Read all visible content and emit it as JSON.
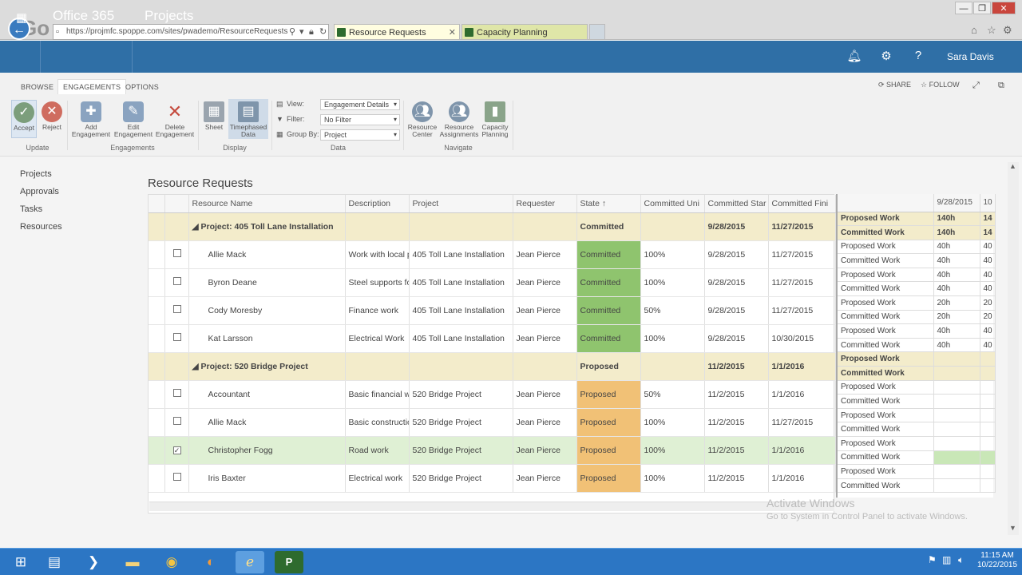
{
  "browser": {
    "address": "https://projmfc.spoppe.com/sites/pwademo/ResourceRequests",
    "tabs": [
      {
        "label": "Resource Requests"
      },
      {
        "label": "Capacity Planning"
      }
    ],
    "window_controls": [
      "—",
      "❐",
      "✕"
    ],
    "google_logo": "Go"
  },
  "suite": {
    "waffle_icon": "app-launcher-icon",
    "brand": "Office 365",
    "app": "Projects",
    "user": "Sara Davis"
  },
  "ribbon": {
    "tabs": [
      "BROWSE",
      "ENGAGEMENTS",
      "OPTIONS"
    ],
    "share": "SHARE",
    "follow": "FOLLOW",
    "groups": {
      "update": "Update",
      "engagements": "Engagements",
      "display": "Display",
      "data": "Data",
      "navigate": "Navigate"
    },
    "buttons": {
      "accept": "Accept",
      "reject": "Reject",
      "add_engagement": "Add Engagement",
      "edit_engagement": "Edit Engagement",
      "delete_engagement": "Delete Engagement",
      "sheet": "Sheet",
      "timephased": "Timephased Data",
      "resource_center": "Resource Center",
      "resource_assignments": "Resource Assignments",
      "capacity_planning": "Capacity Planning"
    },
    "data": {
      "view_label": "View:",
      "view_value": "Engagement Details",
      "filter_label": "Filter:",
      "filter_value": "No Filter",
      "groupby_label": "Group By:",
      "groupby_value": "Project"
    }
  },
  "nav": [
    "Projects",
    "Approvals",
    "Tasks",
    "Resources"
  ],
  "page_title": "Resource Requests",
  "grid": {
    "columns": [
      "Resource Name",
      "Description",
      "Project",
      "Requester",
      "State ↑",
      "Committed Uni",
      "Committed Star",
      "Committed Fini"
    ],
    "groups": [
      {
        "label": "Project: 405 Toll Lane Installation",
        "state": "Committed",
        "start": "9/28/2015",
        "finish": "11/27/2015",
        "rows": [
          {
            "name": "Allie Mack",
            "desc": "Work with local p",
            "project": "405 Toll Lane Installation",
            "requester": "Jean Pierce",
            "state": "Committed",
            "units": "100%",
            "start": "9/28/2015",
            "finish": "11/27/2015"
          },
          {
            "name": "Byron Deane",
            "desc": "Steel supports fo",
            "project": "405 Toll Lane Installation",
            "requester": "Jean Pierce",
            "state": "Committed",
            "units": "100%",
            "start": "9/28/2015",
            "finish": "11/27/2015"
          },
          {
            "name": "Cody Moresby",
            "desc": "Finance work",
            "project": "405 Toll Lane Installation",
            "requester": "Jean Pierce",
            "state": "Committed",
            "units": "50%",
            "start": "9/28/2015",
            "finish": "11/27/2015"
          },
          {
            "name": "Kat Larsson",
            "desc": "Electrical Work",
            "project": "405 Toll Lane Installation",
            "requester": "Jean Pierce",
            "state": "Committed",
            "units": "100%",
            "start": "9/28/2015",
            "finish": "10/30/2015"
          }
        ]
      },
      {
        "label": "Project: 520 Bridge Project",
        "state": "Proposed",
        "start": "11/2/2015",
        "finish": "1/1/2016",
        "rows": [
          {
            "name": "Accountant",
            "desc": "Basic financial w",
            "project": "520 Bridge Project",
            "requester": "Jean Pierce",
            "state": "Proposed",
            "units": "50%",
            "start": "11/2/2015",
            "finish": "1/1/2016"
          },
          {
            "name": "Allie Mack",
            "desc": "Basic constructio",
            "project": "520 Bridge Project",
            "requester": "Jean Pierce",
            "state": "Proposed",
            "units": "100%",
            "start": "11/2/2015",
            "finish": "11/27/2015"
          },
          {
            "name": "Christopher Fogg",
            "desc": "Road work",
            "project": "520 Bridge Project",
            "requester": "Jean Pierce",
            "state": "Proposed",
            "units": "100%",
            "start": "11/2/2015",
            "finish": "1/1/2016",
            "checked": true
          },
          {
            "name": "Iris Baxter",
            "desc": "Electrical work",
            "project": "520 Bridge Project",
            "requester": "Jean Pierce",
            "state": "Proposed",
            "units": "100%",
            "start": "11/2/2015",
            "finish": "1/1/2016"
          }
        ]
      }
    ]
  },
  "timephased": {
    "headers": [
      "",
      "9/28/2015",
      "10"
    ],
    "rows": [
      {
        "label": "Proposed Work",
        "v1": "140h",
        "v2": "14",
        "total": true
      },
      {
        "label": "Committed Work",
        "v1": "140h",
        "v2": "14",
        "total": true
      },
      {
        "label": "Proposed Work",
        "v1": "40h",
        "v2": "40"
      },
      {
        "label": "Committed Work",
        "v1": "40h",
        "v2": "40"
      },
      {
        "label": "Proposed Work",
        "v1": "40h",
        "v2": "40"
      },
      {
        "label": "Committed Work",
        "v1": "40h",
        "v2": "40"
      },
      {
        "label": "Proposed Work",
        "v1": "20h",
        "v2": "20"
      },
      {
        "label": "Committed Work",
        "v1": "20h",
        "v2": "20"
      },
      {
        "label": "Proposed Work",
        "v1": "40h",
        "v2": "40"
      },
      {
        "label": "Committed Work",
        "v1": "40h",
        "v2": "40"
      },
      {
        "label": "Proposed Work",
        "v1": "",
        "v2": "",
        "total": true
      },
      {
        "label": "Committed Work",
        "v1": "",
        "v2": "",
        "total": true
      },
      {
        "label": "Proposed Work",
        "v1": "",
        "v2": ""
      },
      {
        "label": "Committed Work",
        "v1": "",
        "v2": ""
      },
      {
        "label": "Proposed Work",
        "v1": "",
        "v2": ""
      },
      {
        "label": "Committed Work",
        "v1": "",
        "v2": ""
      },
      {
        "label": "Proposed Work",
        "v1": "",
        "v2": ""
      },
      {
        "label": "Committed Work",
        "v1": "",
        "v2": "",
        "selected": true
      },
      {
        "label": "Proposed Work",
        "v1": "",
        "v2": ""
      },
      {
        "label": "Committed Work",
        "v1": "",
        "v2": ""
      }
    ]
  },
  "watermark": {
    "line1": "Activate Windows",
    "line2": "Go to System in Control Panel to activate Windows."
  },
  "taskbar": {
    "time": "11:15 AM",
    "date": "10/22/2015"
  }
}
